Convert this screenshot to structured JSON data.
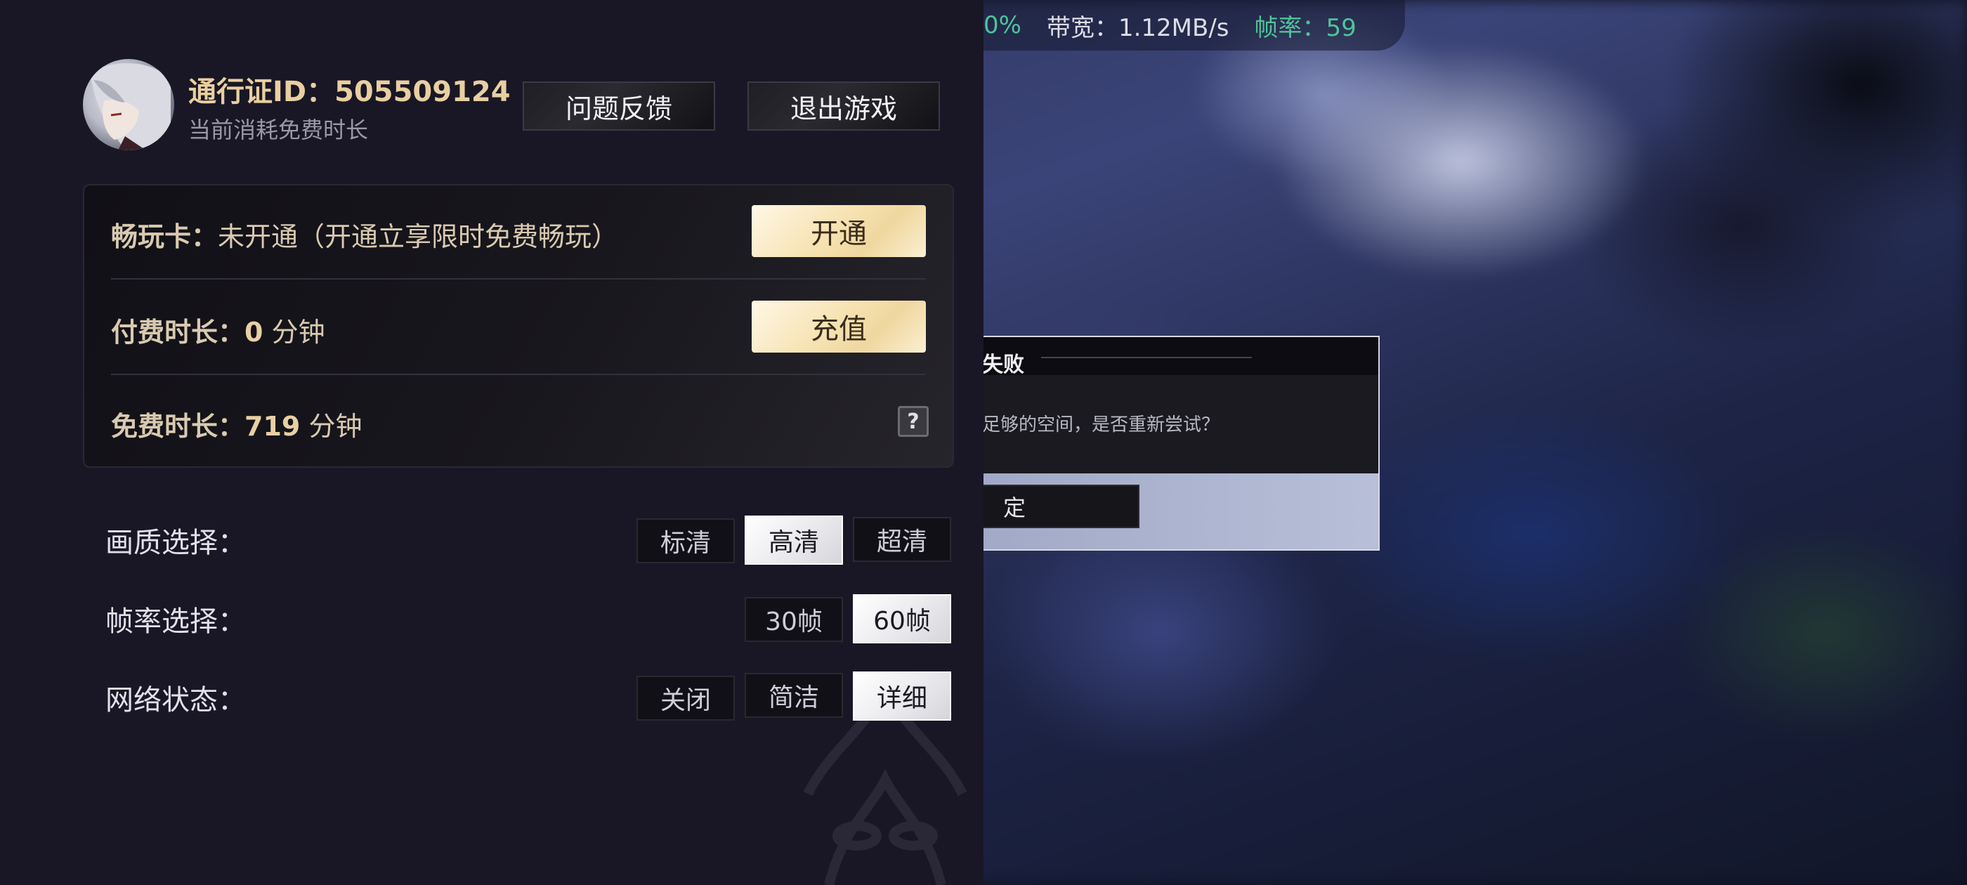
{
  "stats_bar": {
    "loss_partial": "0%",
    "bandwidth_label": "带宽：",
    "bandwidth_value": "1.12MB/s",
    "fps_label": "帧率：",
    "fps_value": "59"
  },
  "error_dialog": {
    "title_partial": "失败",
    "message_partial": "足够的空间，是否重新尝试？",
    "confirm_partial": "定"
  },
  "account": {
    "pass_id": "通行证ID：505509124",
    "subtitle": "当前消耗免费时长",
    "feedback_label": "问题反馈",
    "exit_label": "退出游戏"
  },
  "card": {
    "pass_label": "畅玩卡：",
    "pass_status": "未开通（开通立享限时免费畅玩）",
    "activate_label": "开通",
    "paid_label": "付费时长：",
    "paid_value": "0",
    "paid_unit": "分钟",
    "recharge_label": "充值",
    "free_label": "免费时长：",
    "free_value": "719",
    "free_unit": "分钟",
    "help_symbol": "?"
  },
  "settings": {
    "quality": {
      "label": "画质选择：",
      "options": [
        "标清",
        "高清",
        "超清"
      ],
      "selected": "高清"
    },
    "framerate": {
      "label": "帧率选择：",
      "options": [
        "30帧",
        "60帧"
      ],
      "selected": "60帧"
    },
    "network": {
      "label": "网络状态：",
      "options": [
        "关闭",
        "简洁",
        "详细"
      ],
      "selected": "详细"
    }
  },
  "colors": {
    "gold_text": "#e9cfa0",
    "panel_bg": "#191726",
    "stats_green": "#4fc49a"
  }
}
